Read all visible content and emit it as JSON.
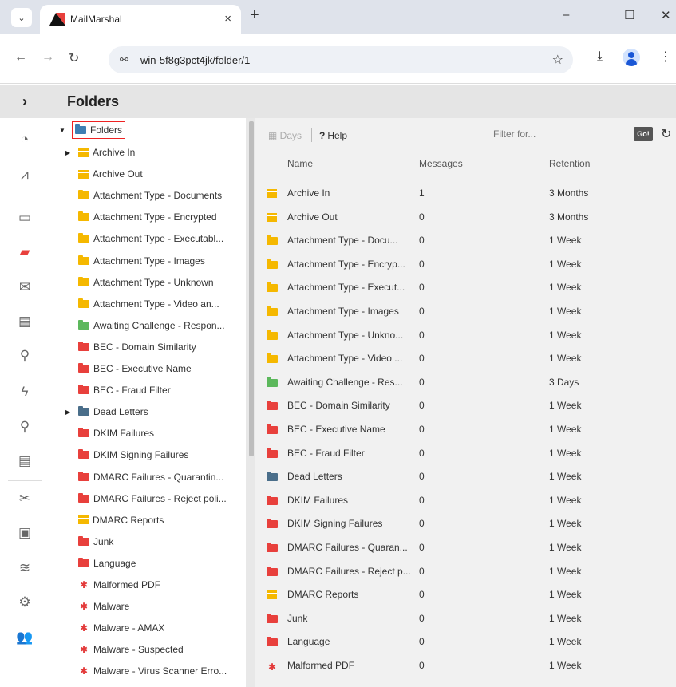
{
  "browser": {
    "tab_title": "MailMarshal",
    "tab_close": "×",
    "new_tab": "+",
    "url": "win-5f8g3pct4jk/folder/1",
    "minimize": "–",
    "maximize": "☐",
    "close": "✕"
  },
  "app": {
    "title": "Folders",
    "sidebar_toggle": "›"
  },
  "iconbar": [
    {
      "name": "dashboard-icon",
      "glyph": "◔"
    },
    {
      "name": "reports-chart-icon",
      "glyph": "⩘"
    },
    {
      "name": "drive-icon",
      "glyph": "▭"
    },
    {
      "name": "folders-icon",
      "glyph": "▰"
    },
    {
      "name": "mail-icon",
      "glyph": "✉"
    },
    {
      "name": "document-icon",
      "glyph": "▤"
    },
    {
      "name": "search-icon",
      "glyph": "⚲"
    },
    {
      "name": "lightning-icon",
      "glyph": "ϟ"
    },
    {
      "name": "search-icon-2",
      "glyph": "⚲"
    },
    {
      "name": "document-icon-2",
      "glyph": "▤"
    },
    {
      "name": "tools-icon",
      "glyph": "✂"
    },
    {
      "name": "briefcase-icon",
      "glyph": "▣"
    },
    {
      "name": "layers-icon",
      "glyph": "≋"
    },
    {
      "name": "gears-icon",
      "glyph": "⚙"
    },
    {
      "name": "users-icon",
      "glyph": "👥"
    }
  ],
  "tree": {
    "root": "Folders",
    "items": [
      {
        "label": "Archive In",
        "type": "archive",
        "expandable": true
      },
      {
        "label": "Archive Out",
        "type": "archive",
        "expandable": false
      },
      {
        "label": "Attachment Type - Documents",
        "type": "yellow",
        "expandable": false
      },
      {
        "label": "Attachment Type - Encrypted",
        "type": "yellow",
        "expandable": false
      },
      {
        "label": "Attachment Type - Executabl...",
        "type": "yellow",
        "expandable": false
      },
      {
        "label": "Attachment Type - Images",
        "type": "yellow",
        "expandable": false
      },
      {
        "label": "Attachment Type - Unknown",
        "type": "yellow",
        "expandable": false
      },
      {
        "label": "Attachment Type - Video an...",
        "type": "yellow",
        "expandable": false
      },
      {
        "label": "Awaiting Challenge - Respon...",
        "type": "green",
        "expandable": false
      },
      {
        "label": "BEC - Domain Similarity",
        "type": "red",
        "expandable": false
      },
      {
        "label": "BEC - Executive Name",
        "type": "red",
        "expandable": false
      },
      {
        "label": "BEC - Fraud Filter",
        "type": "red",
        "expandable": false
      },
      {
        "label": "Dead Letters",
        "type": "blue",
        "expandable": true
      },
      {
        "label": "DKIM Failures",
        "type": "red",
        "expandable": false
      },
      {
        "label": "DKIM Signing Failures",
        "type": "red",
        "expandable": false
      },
      {
        "label": "DMARC Failures - Quarantin...",
        "type": "red",
        "expandable": false
      },
      {
        "label": "DMARC Failures - Reject poli...",
        "type": "red",
        "expandable": false
      },
      {
        "label": "DMARC Reports",
        "type": "archive",
        "expandable": false
      },
      {
        "label": "Junk",
        "type": "red",
        "expandable": false
      },
      {
        "label": "Language",
        "type": "red",
        "expandable": false
      },
      {
        "label": "Malformed PDF",
        "type": "bug",
        "expandable": false
      },
      {
        "label": "Malware",
        "type": "bug",
        "expandable": false
      },
      {
        "label": "Malware - AMAX",
        "type": "bug",
        "expandable": false
      },
      {
        "label": "Malware - Suspected",
        "type": "bug",
        "expandable": false
      },
      {
        "label": "Malware - Virus Scanner Erro...",
        "type": "bug",
        "expandable": false
      }
    ]
  },
  "toolbar": {
    "days_label": "Days",
    "help_label": "Help",
    "filter_placeholder": "Filter for...",
    "go_label": "Go!"
  },
  "grid": {
    "columns": [
      "Name",
      "Messages",
      "Retention"
    ],
    "rows": [
      {
        "name": "Archive In",
        "messages": "1",
        "retention": "3 Months",
        "type": "archive"
      },
      {
        "name": "Archive Out",
        "messages": "0",
        "retention": "3 Months",
        "type": "archive"
      },
      {
        "name": "Attachment Type - Docu...",
        "messages": "0",
        "retention": "1 Week",
        "type": "yellow"
      },
      {
        "name": "Attachment Type - Encryp...",
        "messages": "0",
        "retention": "1 Week",
        "type": "yellow"
      },
      {
        "name": "Attachment Type - Execut...",
        "messages": "0",
        "retention": "1 Week",
        "type": "yellow"
      },
      {
        "name": "Attachment Type - Images",
        "messages": "0",
        "retention": "1 Week",
        "type": "yellow"
      },
      {
        "name": "Attachment Type - Unkno...",
        "messages": "0",
        "retention": "1 Week",
        "type": "yellow"
      },
      {
        "name": "Attachment Type - Video ...",
        "messages": "0",
        "retention": "1 Week",
        "type": "yellow"
      },
      {
        "name": "Awaiting Challenge - Res...",
        "messages": "0",
        "retention": "3 Days",
        "type": "green"
      },
      {
        "name": "BEC - Domain Similarity",
        "messages": "0",
        "retention": "1 Week",
        "type": "red"
      },
      {
        "name": "BEC - Executive Name",
        "messages": "0",
        "retention": "1 Week",
        "type": "red"
      },
      {
        "name": "BEC - Fraud Filter",
        "messages": "0",
        "retention": "1 Week",
        "type": "red"
      },
      {
        "name": "Dead Letters",
        "messages": "0",
        "retention": "1 Week",
        "type": "blue"
      },
      {
        "name": "DKIM Failures",
        "messages": "0",
        "retention": "1 Week",
        "type": "red"
      },
      {
        "name": "DKIM Signing Failures",
        "messages": "0",
        "retention": "1 Week",
        "type": "red"
      },
      {
        "name": "DMARC Failures - Quaran...",
        "messages": "0",
        "retention": "1 Week",
        "type": "red"
      },
      {
        "name": "DMARC Failures - Reject p...",
        "messages": "0",
        "retention": "1 Week",
        "type": "red"
      },
      {
        "name": "DMARC Reports",
        "messages": "0",
        "retention": "1 Week",
        "type": "archive"
      },
      {
        "name": "Junk",
        "messages": "0",
        "retention": "1 Week",
        "type": "red"
      },
      {
        "name": "Language",
        "messages": "0",
        "retention": "1 Week",
        "type": "red"
      },
      {
        "name": "Malformed PDF",
        "messages": "0",
        "retention": "1 Week",
        "type": "bug"
      }
    ]
  },
  "colors": {
    "yellow": "#f5b800",
    "red": "#e8403c",
    "green": "#5cb85c",
    "blue": "#4a6e8a",
    "archive": "#f5b800",
    "root": "#3e7fb3"
  }
}
